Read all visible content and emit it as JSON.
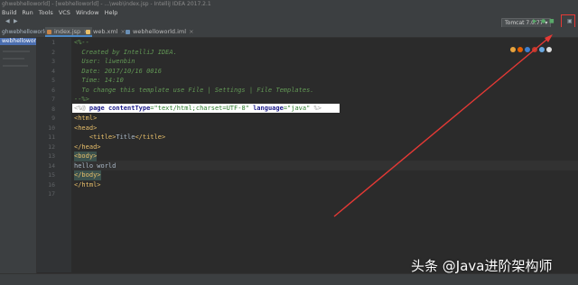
{
  "window": {
    "title": "ghwebhelloworld] - [webhelloworld] - ...\\web\\index.jsp - IntelliJ IDEA 2017.2.1"
  },
  "menu": [
    "Build",
    "Run",
    "Tools",
    "VCS",
    "Window",
    "Help"
  ],
  "toolbar": {
    "run_config": "Tomcat 7.0.77 ▾"
  },
  "project_label": "ghwebhelloworld",
  "tabs": [
    {
      "label": "index.jsp",
      "active": true
    },
    {
      "label": "web.xml",
      "active": false
    },
    {
      "label": "webhelloworld.iml",
      "active": false
    }
  ],
  "left_panel": {
    "selected": "webhelloworld"
  },
  "editor": {
    "line_numbers": [
      "1",
      "2",
      "3",
      "4",
      "5",
      "6",
      "7",
      "8",
      "9",
      "10",
      "11",
      "12",
      "13",
      "14",
      "15",
      "16",
      "17"
    ],
    "lines": {
      "l1": "<%--",
      "l2": "  Created by IntelliJ IDEA.",
      "l3": "  User: liwenbin",
      "l4": "  Date: 2017/10/16 0016",
      "l5": "  Time: 14:10",
      "l6": "  To change this template use File | Settings | File Templates.",
      "l7": "--%>",
      "l8_open": "<%@ ",
      "l8_page": "page",
      "l8_ct_attr": "contentType",
      "l8_ct_val": "=\"text/html;charset=UTF-8\"",
      "l8_lang_attr": "language",
      "l8_lang_val": "=\"java\"",
      "l8_close": " %>",
      "l9": "<html>",
      "l10": "<head>",
      "l11_open": "    <title>",
      "l11_text": "Title",
      "l11_close": "</title>",
      "l12": "</head>",
      "l13": "<body>",
      "l14": "hello world",
      "l15": "</body>",
      "l16": "</html>"
    }
  },
  "watermark": "头条 @Java进阶架构师",
  "colors": {
    "annotation_red": "#e53935",
    "accent_blue": "#4a88c7"
  }
}
